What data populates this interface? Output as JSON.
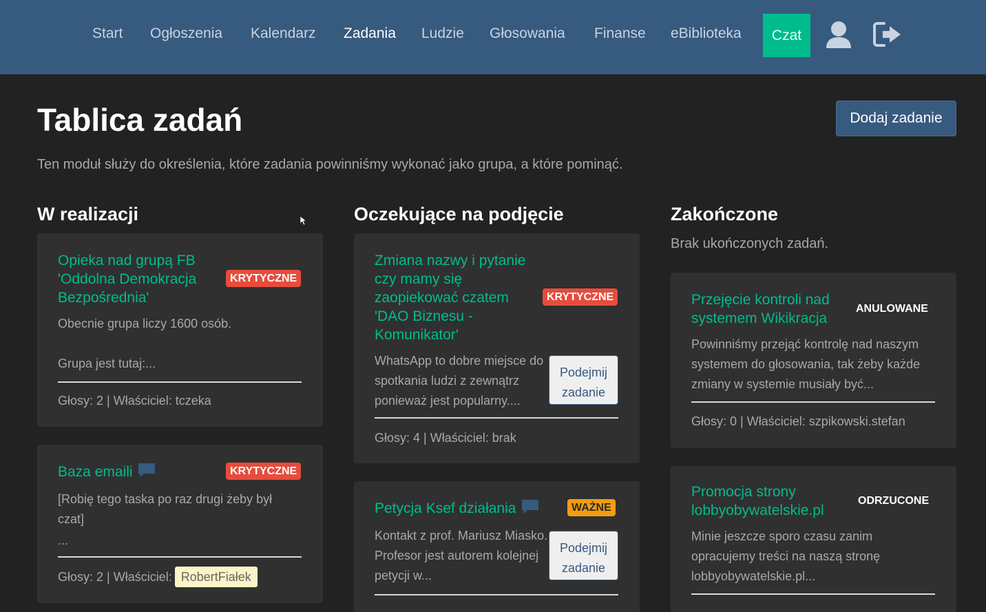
{
  "nav": {
    "items": [
      "Start",
      "Ogłoszenia",
      "Kalendarz",
      "Zadania",
      "Ludzie",
      "Głosowania",
      "Finanse",
      "eBiblioteka"
    ],
    "chat": "Czat"
  },
  "page": {
    "title": "Tablica zadań",
    "add_button": "Dodaj zadanie",
    "intro": "Ten moduł służy do określenia, które zadania powinniśmy wykonać jako grupa, a które pominąć."
  },
  "columns": {
    "in_progress": {
      "title": "W realizacji",
      "cards": [
        {
          "title": "Opieka nad grupą FB 'Oddolna Demokracja Bezpośrednia'",
          "badge": "KRYTYCZNE",
          "desc1": "Obecnie grupa liczy 1600 osób.",
          "desc2": "Grupa jest tutaj:...",
          "meta": "Głosy: 2 | Właściciel: tczeka"
        },
        {
          "title": "Baza emaili",
          "badge": "KRYTYCZNE",
          "desc": "[Robię tego taska po raz drugi żeby był czat]",
          "desc2": "...",
          "meta": "Głosy: 2 | Właściciel:",
          "owner": "RobertFiałek"
        }
      ]
    },
    "pending": {
      "title": "Oczekujące na podjęcie",
      "cards": [
        {
          "title": "Zmiana nazwy i pytanie czy mamy się zaopiekować czatem 'DAO Biznesu - Komunikator'",
          "badge": "KRYTYCZNE",
          "desc": "WhatsApp to dobre miejsce do spotkania ludzi z zewnątrz ponieważ jest popularny....",
          "take": "Podejmij zadanie",
          "meta": "Głosy: 4 | Właściciel: brak"
        },
        {
          "title": "Petycja Ksef działania",
          "badge": "WAŻNE",
          "desc": "Kontakt z prof. Mariusz Miasko. Profesor jest autorem kolejnej petycji w...",
          "take": "Podejmij zadanie"
        }
      ]
    },
    "done": {
      "title": "Zakończone",
      "empty": "Brak ukończonych zadań.",
      "cards": [
        {
          "title": "Przejęcie kontroli nad systemem Wikikracja",
          "badge": "ANULOWANE",
          "desc": "Powinniśmy przejąć kontrolę nad naszym systemem do głosowania, tak żeby każde zmiany w systemie musiały być...",
          "meta": "Głosy: 0 | Właściciel: szpikowski.stefan"
        },
        {
          "title": "Promocja strony lobbyobywatelskie.pl",
          "badge": "ODRZUCONE",
          "desc": "Minie jeszcze sporo czasu zanim opracujemy treści na naszą stronę lobbyobywatelskie.pl..."
        }
      ]
    }
  },
  "icons": [
    "user-icon",
    "logout-icon",
    "chat-bubble-icon",
    "mouse-cursor-icon"
  ],
  "colors": {
    "navbar": "#375a7f",
    "background": "#222222",
    "card": "#303030",
    "accent": "#00bc8c",
    "critical": "#e74c3c",
    "important": "#f39c12",
    "owner_chip": "#fdf3c7"
  }
}
